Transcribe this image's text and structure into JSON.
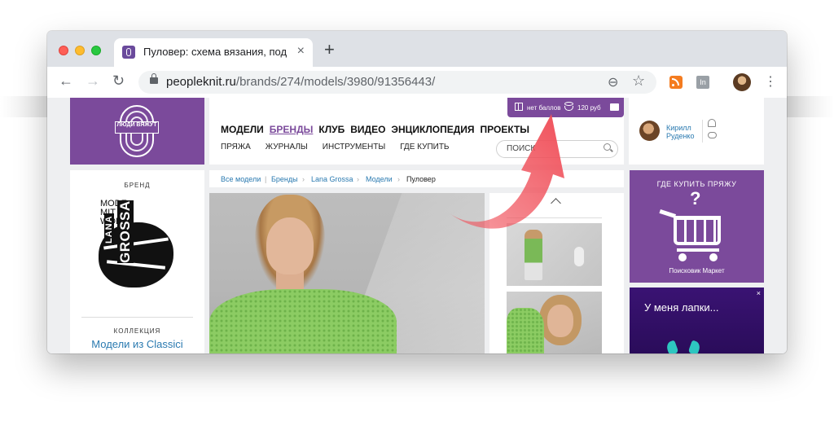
{
  "browser": {
    "tab_title": "Пуловер: схема вязания, подр",
    "tab_close": "×",
    "new_tab": "+",
    "url_domain": "peopleknit.ru",
    "url_path": "/brands/274/models/3980/91356443/",
    "ext_label": "In"
  },
  "site": {
    "logo_text": "ЛЮДИ ВЯЖУТ",
    "nav_main": [
      "МОДЕЛИ",
      "БРЕНДЫ",
      "КЛУБ",
      "ВИДЕО",
      "ЭНЦИКЛОПЕДИЯ",
      "ПРОЕКТЫ"
    ],
    "nav_main_active": "БРЕНДЫ",
    "nav_sub": [
      "ПРЯЖА",
      "ЖУРНАЛЫ",
      "ИНСТРУМЕНТЫ",
      "ГДЕ КУПИТЬ"
    ],
    "search_placeholder": "ПОИСК",
    "points": {
      "no_points": "нет баллов",
      "balance": "120 руб"
    },
    "user": {
      "name": "Кирилл Руденко"
    }
  },
  "brand_panel": {
    "label": "БРЕНД",
    "logo_top": "MODE MIT WOLLE",
    "logo_lana": "LANA",
    "logo_grossa": "GROSSA",
    "collection_label": "КОЛЛЕКЦИЯ",
    "collection_link": "Модели из Classici"
  },
  "breadcrumbs": {
    "items": [
      "Все модели",
      "Бренды",
      "Lana Grossa",
      "Модели"
    ],
    "current": "Пуловер"
  },
  "buy_panel": {
    "title": "ГДЕ КУПИТЬ ПРЯЖУ",
    "question": "?",
    "subtitle": "Поисковик Маркет"
  },
  "ad": {
    "text": "У меня лапки...",
    "close": "×"
  },
  "colors": {
    "brand_purple": "#7b4a9b",
    "link_blue": "#2a7ab0",
    "arrow_red": "#f0505a"
  },
  "icons": [
    "back-icon",
    "forward-icon",
    "reload-icon",
    "lock-icon",
    "zoom-icon",
    "star-icon",
    "rss-icon",
    "menu-icon",
    "search-icon",
    "gift-icon",
    "coins-icon",
    "wallet-icon",
    "bell-icon",
    "chat-icon",
    "cart-icon",
    "chevron-up-icon",
    "callout-arrow-icon"
  ]
}
